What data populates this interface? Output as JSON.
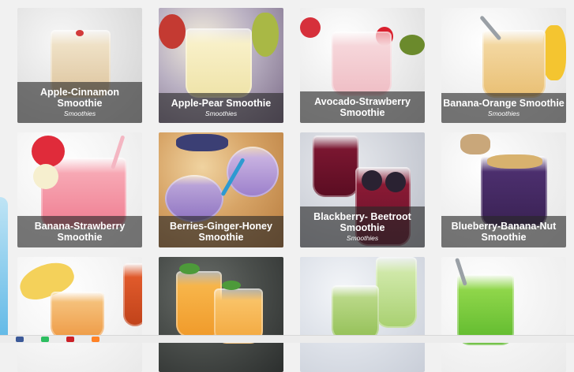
{
  "recipes": [
    {
      "title": "Apple-Cinnamon Smoothie",
      "category": "Smoothies"
    },
    {
      "title": "Apple-Pear Smoothie",
      "category": "Smoothies"
    },
    {
      "title": "Avocado-Strawberry Smoothie",
      "category": ""
    },
    {
      "title": "Banana-Orange Smoothie",
      "category": "Smoothies"
    },
    {
      "title": "Banana-Strawberry Smoothie",
      "category": ""
    },
    {
      "title": "Berries-Ginger-Honey Smoothie",
      "category": ""
    },
    {
      "title": "Blackberry- Beetroot Smoothie",
      "category": "Smoothies"
    },
    {
      "title": "Blueberry-Banana-Nut Smoothie",
      "category": ""
    },
    {
      "title": "",
      "category": ""
    },
    {
      "title": "",
      "category": ""
    },
    {
      "title": "",
      "category": ""
    },
    {
      "title": "",
      "category": ""
    }
  ],
  "colors": {
    "background": "#f1f1f1",
    "caption_overlay": "rgba(40,40,40,0.62)",
    "accent_left": "#5fb8e6"
  },
  "icons": [
    "facebook-icon",
    "evernote-icon",
    "pinterest-icon",
    "mix-icon"
  ]
}
